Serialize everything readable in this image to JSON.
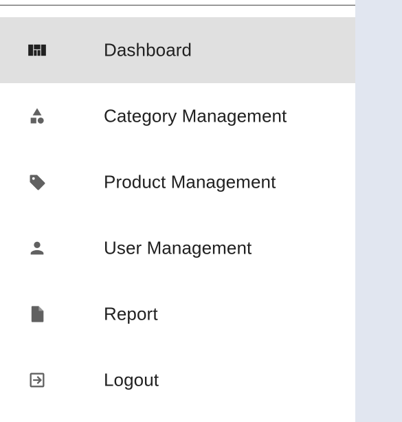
{
  "sidebar": {
    "items": [
      {
        "label": "Dashboard",
        "icon": "dashboard-icon",
        "active": true
      },
      {
        "label": "Category Management",
        "icon": "category-icon",
        "active": false
      },
      {
        "label": "Product Management",
        "icon": "tag-icon",
        "active": false
      },
      {
        "label": "User Management",
        "icon": "person-icon",
        "active": false
      },
      {
        "label": "Report",
        "icon": "document-icon",
        "active": false
      },
      {
        "label": "Logout",
        "icon": "logout-icon",
        "active": false
      }
    ]
  },
  "colors": {
    "active_bg": "#e0e0e0",
    "icon": "#616161",
    "text": "#212121",
    "content_bg": "#e1e6f0"
  }
}
